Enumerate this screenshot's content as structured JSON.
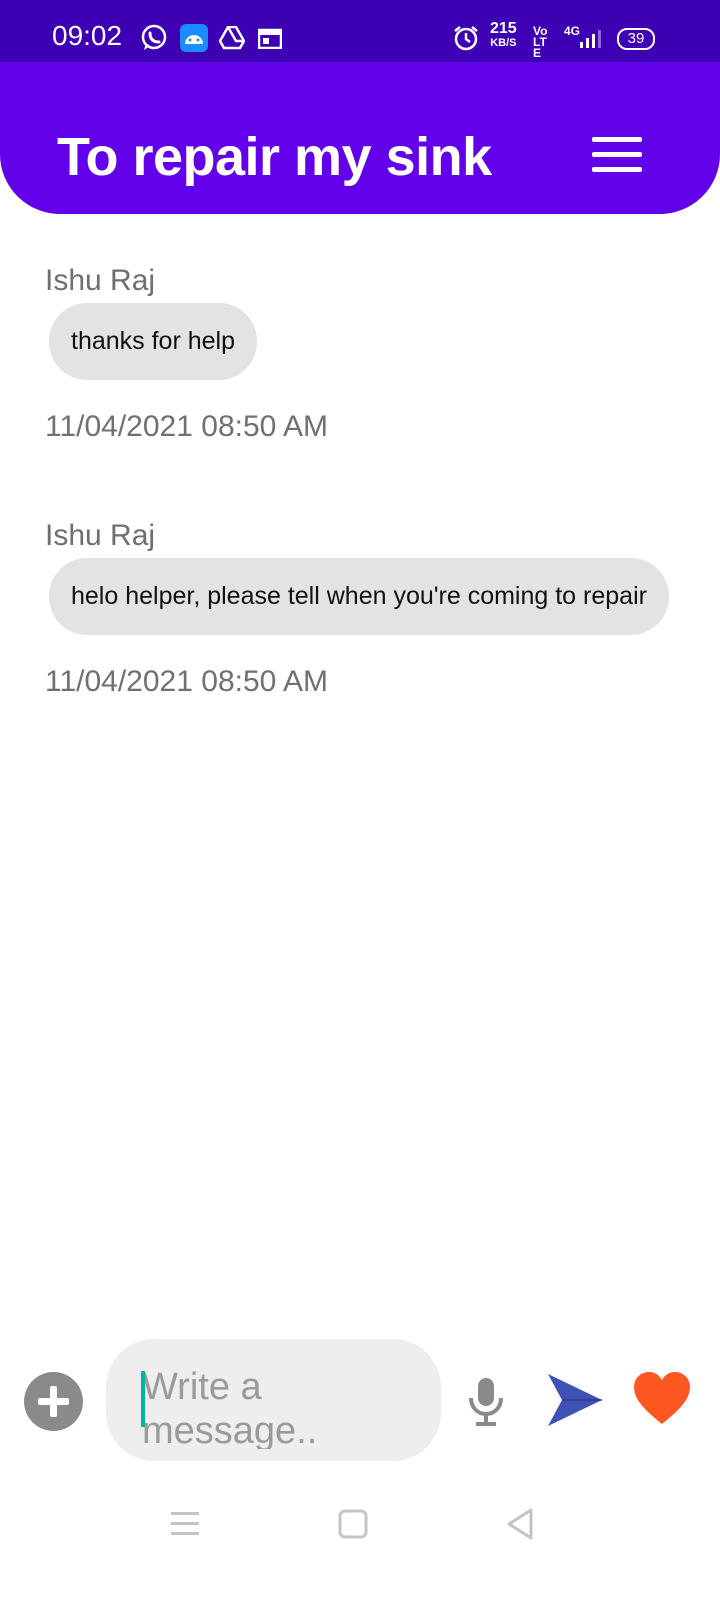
{
  "status_bar": {
    "time": "09:02",
    "net_speed": "215",
    "net_speed_unit": "KB/S",
    "volte": "Vo LTE",
    "network": "4G",
    "battery": "39"
  },
  "header": {
    "title": "To repair my sink",
    "menu_icon": "hamburger-menu-icon"
  },
  "messages": [
    {
      "sender": "Ishu Raj",
      "text": "thanks for help",
      "time": "11/04/2021 08:50 AM"
    },
    {
      "sender": "Ishu Raj",
      "text": "helo helper, please tell when you're coming to repair",
      "time": "11/04/2021 08:50 AM"
    }
  ],
  "composer": {
    "placeholder": "Write a message..",
    "add_icon": "plus-circle-icon",
    "mic_icon": "microphone-icon",
    "send_icon": "send-icon",
    "like_icon": "heart-icon"
  },
  "colors": {
    "status_bar": "#3d00b3",
    "header": "#6200ea",
    "bubble": "#e3e3e3",
    "send": "#3f51b5",
    "heart": "#ff5722",
    "caret": "#00b3a4"
  }
}
